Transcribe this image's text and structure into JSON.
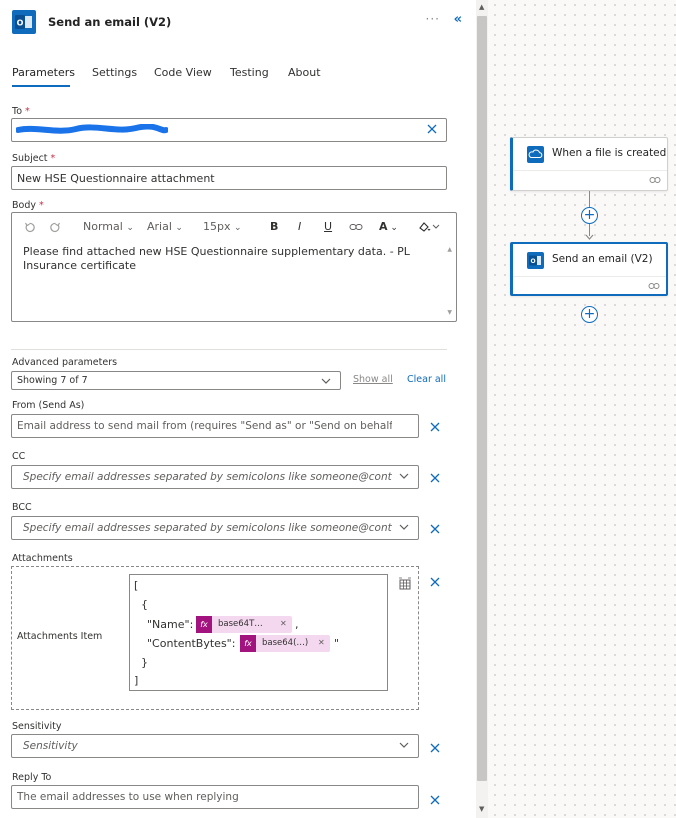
{
  "header": {
    "title": "Send an email (V2)",
    "more": "···",
    "collapse": "«"
  },
  "tabs": [
    {
      "label": "Parameters",
      "active": true
    },
    {
      "label": "Settings",
      "active": false
    },
    {
      "label": "Code View",
      "active": false
    },
    {
      "label": "Testing",
      "active": false
    },
    {
      "label": "About",
      "active": false
    }
  ],
  "to": {
    "label": "To",
    "required": "*"
  },
  "subject": {
    "label": "Subject",
    "required": "*",
    "value": "New HSE Questionnaire attachment"
  },
  "body": {
    "label": "Body",
    "required": "*",
    "toolbar": {
      "format": "Normal",
      "font": "Arial",
      "size": "15px",
      "bold": "B",
      "italic": "I",
      "underline": "U",
      "color": "A"
    },
    "text": "Please find attached new HSE Questionnaire supplementary data. - PL Insurance certificate"
  },
  "advanced": {
    "label": "Advanced parameters",
    "selected": "Showing 7 of 7",
    "show_all": "Show all",
    "clear_all": "Clear all"
  },
  "from": {
    "label": "From (Send As)",
    "placeholder": "Email address to send mail from (requires \"Send as\" or \"Send on behalf…"
  },
  "cc": {
    "label": "CC",
    "placeholder": "Specify email addresses separated by semicolons like someone@contoso.c…"
  },
  "bcc": {
    "label": "BCC",
    "placeholder": "Specify email addresses separated by semicolons like someone@contoso.c…"
  },
  "attachments": {
    "label": "Attachments",
    "item_label": "Attachments Item",
    "open_bracket": "[",
    "open_brace": "{",
    "name_key": "\"Name\":",
    "name_token": "base64T…",
    "comma": ",",
    "content_key": "\"ContentBytes\": \"",
    "content_token": "base64(…)",
    "close_quote": "\"",
    "close_brace": "}",
    "close_bracket": "]",
    "fx": "fx"
  },
  "sensitivity": {
    "label": "Sensitivity",
    "placeholder": "Sensitivity"
  },
  "reply_to": {
    "label": "Reply To",
    "placeholder": "The email addresses to use when replying"
  },
  "flow": {
    "trigger": "When a file is created",
    "action": "Send an email (V2)",
    "plus": "+"
  },
  "colors": {
    "accent": "#0f6cbd",
    "token_bg": "#f4d8ef",
    "fx_bg": "#a3137f",
    "required": "#c4314b"
  }
}
